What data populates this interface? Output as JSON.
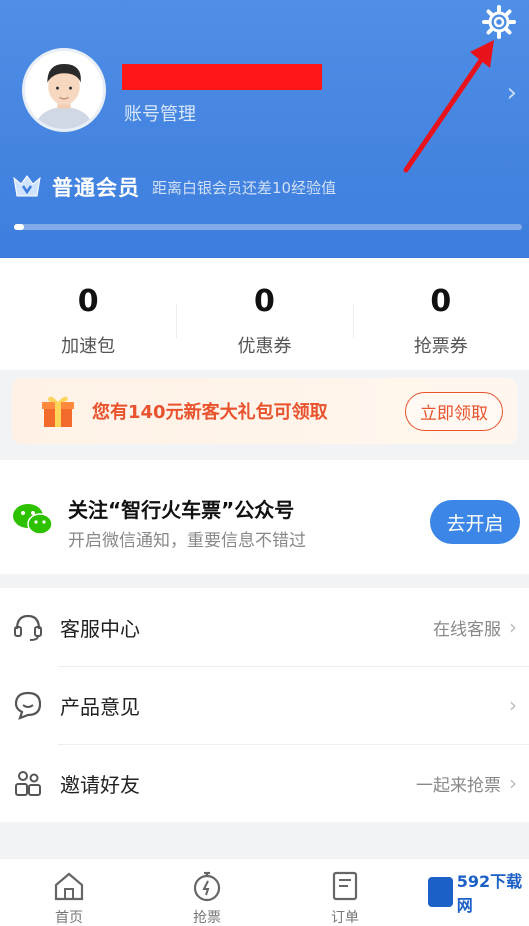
{
  "header": {
    "account_label": "账号管理",
    "member_title": "普通会员",
    "member_desc": "距离白银会员还差10经验值",
    "progress_fraction": 0.02
  },
  "stats": [
    {
      "value": "0",
      "label": "加速包"
    },
    {
      "value": "0",
      "label": "优惠券"
    },
    {
      "value": "0",
      "label": "抢票券"
    }
  ],
  "promo": {
    "text": "您有140元新客大礼包可领取",
    "button": "立即领取"
  },
  "wechat": {
    "title": "关注“智行火车票”公众号",
    "subtitle": "开启微信通知，重要信息不错过",
    "button": "去开启"
  },
  "menu": [
    {
      "label": "客服中心",
      "extra": "在线客服",
      "icon": "headset-icon"
    },
    {
      "label": "产品意见",
      "extra": "",
      "icon": "feedback-icon"
    },
    {
      "label": "邀请好友",
      "extra": "一起来抢票",
      "icon": "friends-icon"
    }
  ],
  "tabs": [
    {
      "label": "首页",
      "icon": "home-icon"
    },
    {
      "label": "抢票",
      "icon": "stopwatch-icon"
    },
    {
      "label": "订单",
      "icon": "order-icon"
    }
  ],
  "watermark": {
    "text": "592下载网"
  },
  "colors": {
    "header": "#3d7ddd",
    "accent": "#e8532d",
    "button_blue": "#3b86e6",
    "redaction": "#ff1616",
    "arrow": "#e8121b"
  }
}
